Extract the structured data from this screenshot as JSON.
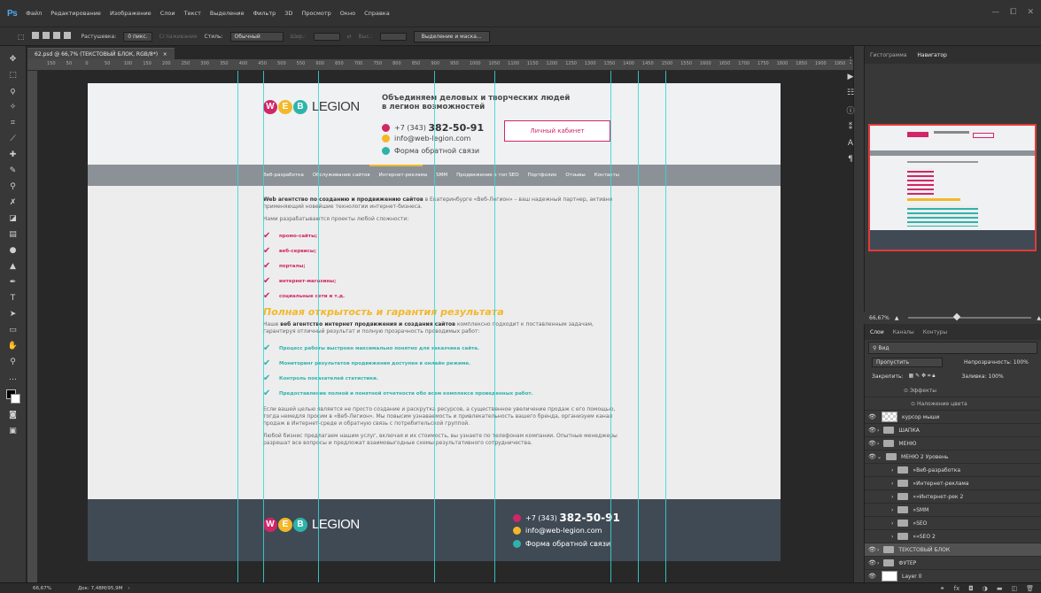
{
  "app": {
    "logo": "Ps",
    "menu": [
      "Файл",
      "Редактирование",
      "Изображение",
      "Слои",
      "Текст",
      "Выделение",
      "Фильтр",
      "3D",
      "Просмотр",
      "Окно",
      "Справка"
    ],
    "window_controls": [
      "—",
      "⧠",
      "✕"
    ]
  },
  "options_bar": {
    "feather_label": "Растушевка:",
    "feather_value": "0 пикс.",
    "antialias": "Сглаживание",
    "style_label": "Стиль:",
    "style_value": "Обычный",
    "width_label": "Шир.:",
    "height_label": "Выс.:",
    "mask_button": "Выделение и маска..."
  },
  "document": {
    "tab_title": "62.psd @ 66,7% (ТЕКСТОВЫЙ БЛОК, RGB/8*)",
    "ruler_labels": [
      "150",
      "50",
      "0",
      "50",
      "100",
      "150",
      "200",
      "250",
      "300",
      "350",
      "400",
      "450",
      "500",
      "550",
      "600",
      "650",
      "700",
      "750",
      "800",
      "850",
      "900",
      "950",
      "1000",
      "1050",
      "1100",
      "1150",
      "1200",
      "1250",
      "1300",
      "1350",
      "1400",
      "1450",
      "1500",
      "1550",
      "1600",
      "1650",
      "1700",
      "1750",
      "1800",
      "1850",
      "1900",
      "1950",
      "2000"
    ]
  },
  "site": {
    "logo_letters": [
      "W",
      "E",
      "B"
    ],
    "logo_word": "LEGION",
    "slogan_line1": "Объединяем деловых и творческих людей",
    "slogan_line2": "в легион возможностей",
    "phone_prefix": "+7 (343)",
    "phone_number": "382-50-91",
    "email": "info@web-legion.com",
    "callback": "Форма обратной связи",
    "cabinet_button": "Личный кабинет",
    "nav": [
      "Веб-разработка",
      "Обслуживание сайтов",
      "Интернет-реклама",
      "SMM",
      "Продвижение в топ SEO",
      "Портфолио",
      "Отзывы",
      "Контакты"
    ],
    "lead_bold": "Web агентство по созданию и продвижению сайтов",
    "lead_rest": " в Екатеринбурге «Веб-Легион» – ваш надежный партнер, активно применяющий новейшие технологии интернет-бизнеса.",
    "projects_intro": "Нами разрабатываются проекты любой сложности:",
    "pink_items": [
      "промо-сайты;",
      "веб-сервисы;",
      "порталы;",
      "интернет-магазины;",
      "социальные сети и т.д."
    ],
    "heading2": "Полная открытость и гарантия результата",
    "p2_pre": "Наше ",
    "p2_bold": "веб агентство интернет продвижения и создания сайтов",
    "p2_rest": " комплексно подходит к поставленным задачам, гарантируя отличный результат и полную прозрачность проводимых работ:",
    "teal_items": [
      "Процесс работы выстроен максимально понятно для заказчика сайта.",
      "Мониторинг результатов продвижения доступен в онлайн режиме.",
      "Контроль показателей статистики.",
      "Предоставление полной и понятной отчетности обо всем комплексе проведенных работ."
    ],
    "p3": "Если вашей целью является не просто создание и раскрутка ресурсов, а существенное увеличение продаж с его помощью, тогда немедля просим в «Веб-Легион». Мы повысим узнаваемость и привлекательность вашего бренда, организуем канал продаж в Интернет-среде и обратную связь с потребительской группой.",
    "p4": "Любой бизнес предлагаем нашим услуг, включая и их стоимость, вы узнаете по телефонам компании. Опытные менеджеры разрешат все вопросы и предложат взаимовыгодные схемы результативного сотрудничества."
  },
  "navigator": {
    "tabs": [
      "Гистограмма",
      "Навигатор"
    ],
    "zoom": "66,67%"
  },
  "layers_panel": {
    "tabs": [
      "Слои",
      "Каналы",
      "Контуры"
    ],
    "filter": "Вид",
    "blend_mode": "Пропустить",
    "opacity_label": "Непрозрачность:",
    "opacity_value": "100%",
    "lock_label": "Закрепить:",
    "fill_label": "Заливка:",
    "fill_value": "100%",
    "effects_label": "Эффекты",
    "color_overlay": "Наложение цвета",
    "rows": [
      "курсор мыши",
      "ШАПКА",
      "МЕНЮ",
      "МЕНЮ 2 Уровень",
      "»Веб-разработка",
      "»Интернет-реклама",
      "»»Интернет-рек 2",
      "»SMM",
      "»SEO",
      "»»SEO 2",
      "ТЕКСТОВЫЙ БЛОК",
      "ФУТЕР",
      "Layer 0"
    ]
  },
  "status": {
    "zoom": "66,67%",
    "doc_info": "Док: 7,48М/95,9М"
  },
  "colors": {
    "pink": "#d12667",
    "teal": "#2eb3ab",
    "yellow": "#f2b82a",
    "guide": "#37d6d6",
    "footer": "#404a55"
  }
}
